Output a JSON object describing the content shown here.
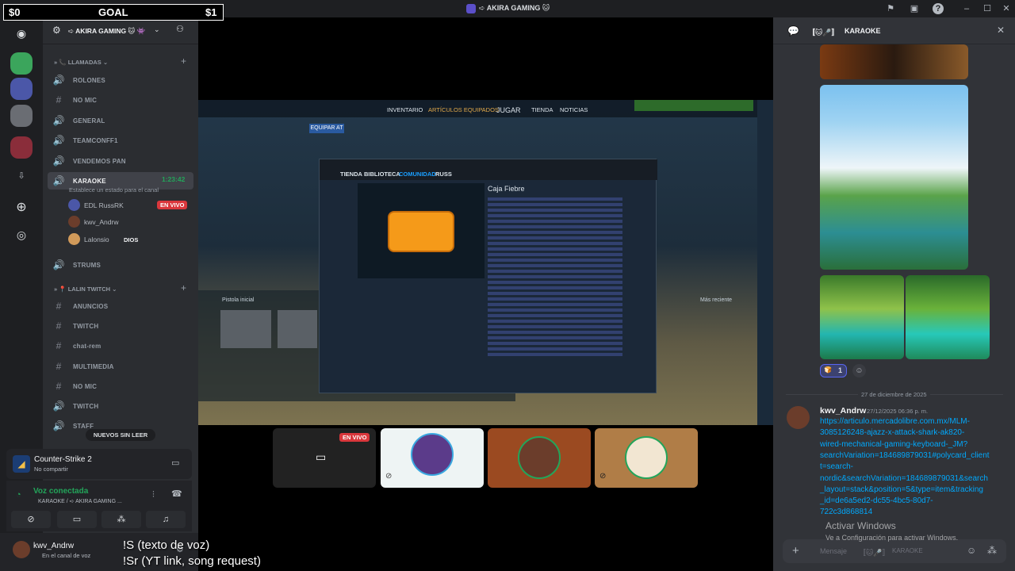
{
  "overlay_goal": {
    "left": "$0",
    "label": "GOAL",
    "right": "$1"
  },
  "window": {
    "title": "➪ AKIRA GAMING 🐱"
  },
  "server": {
    "name": "➪ AKIRA GAMING 🐱 👾"
  },
  "categories": {
    "calls": "LLAMADAS",
    "lalin": "LALIN TWITCH"
  },
  "channels_calls": [
    {
      "name": "ROLONES",
      "icon": "voice"
    },
    {
      "name": "NO MIC",
      "icon": "text"
    },
    {
      "name": "GENERAL",
      "icon": "voice"
    },
    {
      "name": "TEAMCONFF1",
      "icon": "voice"
    },
    {
      "name": "VENDEMOS PAN",
      "icon": "voice"
    },
    {
      "name": "KARAOKE",
      "icon": "voice"
    }
  ],
  "karaoke_meta": {
    "timer": "1:23:42",
    "status_placeholder": "Establece un estado para el canal"
  },
  "voice_users": [
    {
      "name": "EDL RussRK",
      "badge": "EN VIVO"
    },
    {
      "name": "kwv_Andrw",
      "badge": ""
    },
    {
      "name": "Lalonsio",
      "badge": "DIOS"
    }
  ],
  "channels_after": [
    {
      "name": "STRUMS",
      "icon": "voice"
    }
  ],
  "channels_lalin": [
    {
      "name": "ANUNCIOS",
      "icon": "text"
    },
    {
      "name": "TWITCH",
      "icon": "text"
    },
    {
      "name": "chat-rem",
      "icon": "text"
    },
    {
      "name": "MULTIMEDIA",
      "icon": "text"
    },
    {
      "name": "NO MIC",
      "icon": "text"
    },
    {
      "name": "TWITCH",
      "icon": "voice"
    },
    {
      "name": "STAFF",
      "icon": "voice"
    }
  ],
  "new_unread": "NUEVOS SIN LEER",
  "activity": {
    "game": "Counter-Strike 2",
    "sub": "No compartir"
  },
  "voice": {
    "status": "Voz conectada",
    "location": "KARAOKE / ➪ AKIRA GAMING ..."
  },
  "user": {
    "name": "kwv_Andrw",
    "status": "En el canal de voz"
  },
  "game": {
    "tabs": [
      "INVENTARIO",
      "ARTÍCULOS EQUIPADOS",
      "JUGAR",
      "TIENDA",
      "NOTICIAS"
    ],
    "equip": "EQUIPAR AT",
    "pistol": "Pistola inicial",
    "recent": "Más reciente",
    "steam_tabs": [
      "TIENDA",
      "BIBLIOTECA",
      "COMUNIDAD",
      "RUSS"
    ],
    "case_title": "Caja Fiebre"
  },
  "tiles": [
    {
      "badge": "EN VIVO"
    }
  ],
  "right": {
    "header": "KARAOKE",
    "reaction_count": "1",
    "date_divider": "27 de diciembre de 2025",
    "msg_author": "kwv_Andrw",
    "msg_time": "27/12/2025 06:36 p. m.",
    "msg_link_lines": [
      "https://articulo.mercadolibre.com.mx/MLM-",
      "3085126248-ajazz-x-attack-shark-ak820-",
      "wired-mechanical-gaming-keyboard-_JM?",
      "searchVariation=184689879031#polycard_client",
      "t=search-",
      "nordic&searchVariation=184689879031&search",
      "_layout=stack&position=5&type=item&tracking",
      "_id=de6a5ed2-dc55-4bc5-80d7-",
      "722c3d868814"
    ],
    "input_placeholder": "Mensaje",
    "input_channel": "KARAOKE"
  },
  "activate_windows": {
    "title": "Activar Windows",
    "sub": "Ve a Configuración para activar Windows."
  },
  "captions": [
    "!S (texto de voz)",
    "!Sr  (YT link, song request)"
  ]
}
